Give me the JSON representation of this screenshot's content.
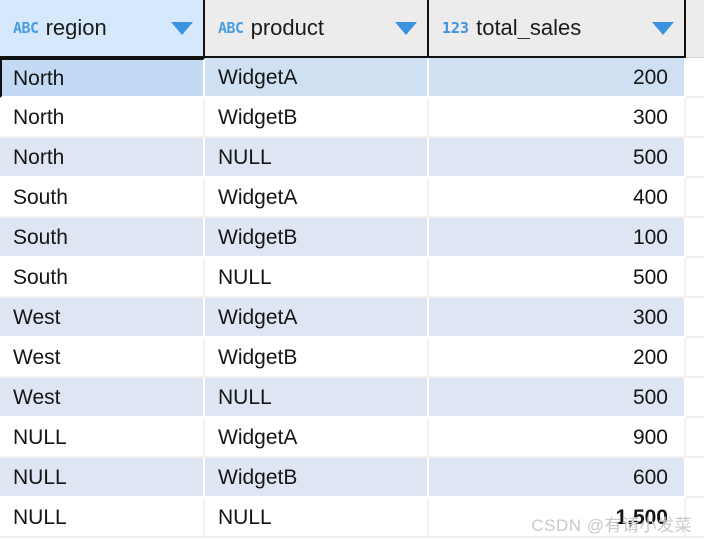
{
  "grid": {
    "columns": [
      {
        "name": "region",
        "type_badge": "ABC",
        "type_icon": "text-type-icon",
        "selected": true
      },
      {
        "name": "product",
        "type_badge": "ABC",
        "type_icon": "text-type-icon",
        "selected": false
      },
      {
        "name": "total_sales",
        "type_badge": "123",
        "type_icon": "number-type-icon",
        "selected": false
      }
    ],
    "rows": [
      {
        "region": "North",
        "product": "WidgetA",
        "total_sales": "200"
      },
      {
        "region": "North",
        "product": "WidgetB",
        "total_sales": "300"
      },
      {
        "region": "North",
        "product": "NULL",
        "total_sales": "500"
      },
      {
        "region": "South",
        "product": "WidgetA",
        "total_sales": "400"
      },
      {
        "region": "South",
        "product": "WidgetB",
        "total_sales": "100"
      },
      {
        "region": "South",
        "product": "NULL",
        "total_sales": "500"
      },
      {
        "region": "West",
        "product": "WidgetA",
        "total_sales": "300"
      },
      {
        "region": "West",
        "product": "WidgetB",
        "total_sales": "200"
      },
      {
        "region": "West",
        "product": "NULL",
        "total_sales": "500"
      },
      {
        "region": "NULL",
        "product": "WidgetA",
        "total_sales": "900"
      },
      {
        "region": "NULL",
        "product": "WidgetB",
        "total_sales": "600"
      },
      {
        "region": "NULL",
        "product": "NULL",
        "total_sales": "1,500"
      }
    ],
    "selection": {
      "row_index": 0,
      "column_index": 0
    },
    "colors": {
      "header_background": "#ececec",
      "header_selected_background": "#d6e8fb",
      "row_odd_background": "#dde6f2",
      "row_even_background": "#ffffff",
      "selected_cell_background": "#c3daf4",
      "selected_cell_border": "#111111",
      "accent_blue": "#3d93e0",
      "text": "#151515"
    }
  },
  "watermark": {
    "text": "CSDN @有请小发菜"
  }
}
